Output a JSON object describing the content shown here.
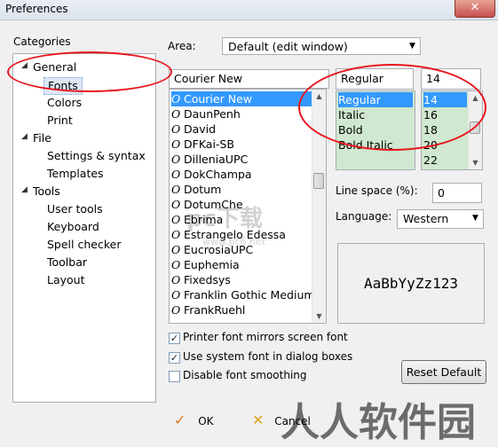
{
  "window": {
    "title": "Preferences",
    "close_glyph": "✕"
  },
  "categories": {
    "label": "Categories",
    "items": [
      {
        "label": "General",
        "level": 0,
        "expanded": true
      },
      {
        "label": "Fonts",
        "level": 1,
        "selected": true
      },
      {
        "label": "Colors",
        "level": 1
      },
      {
        "label": "Print",
        "level": 1
      },
      {
        "label": "File",
        "level": 0,
        "expanded": true
      },
      {
        "label": "Settings & syntax",
        "level": 1
      },
      {
        "label": "Templates",
        "level": 1
      },
      {
        "label": "Tools",
        "level": 0,
        "expanded": true
      },
      {
        "label": "User tools",
        "level": 1
      },
      {
        "label": "Keyboard",
        "level": 1
      },
      {
        "label": "Spell checker",
        "level": 1
      },
      {
        "label": "Toolbar",
        "level": 1
      },
      {
        "label": "Layout",
        "level": 1
      }
    ]
  },
  "area": {
    "label": "Area:",
    "value": "Default (edit window)"
  },
  "font": {
    "current": "Courier New",
    "list": [
      "Courier New",
      "DaunPenh",
      "David",
      "DFKai-SB",
      "DilleniaUPC",
      "DokChampa",
      "Dotum",
      "DotumChe",
      "Ebrima",
      "Estrangelo Edessa",
      "EucrosiaUPC",
      "Euphemia",
      "Fixedsys",
      "Franklin Gothic Medium",
      "FrankRuehl"
    ],
    "selected_index": 0,
    "type_glyph": "O"
  },
  "style": {
    "current": "Regular",
    "options": [
      "Regular",
      "Italic",
      "Bold",
      "Bold Italic"
    ],
    "selected_index": 0
  },
  "size": {
    "current": "14",
    "options": [
      "14",
      "16",
      "18",
      "20",
      "22"
    ],
    "selected_index": 0
  },
  "line_space": {
    "label": "Line space (%):",
    "value": "0"
  },
  "language": {
    "label": "Language:",
    "value": "Western"
  },
  "preview_text": "AaBbYyZz123",
  "checkboxes": [
    {
      "label": "Printer font mirrors screen font",
      "checked": true
    },
    {
      "label": "Use system font in dialog boxes",
      "checked": true
    },
    {
      "label": "Disable font smoothing",
      "checked": false
    }
  ],
  "reset_label": "Reset Default",
  "ok_label": "OK",
  "cancel_label": "Cancel",
  "watermark": {
    "main": "人人软件园",
    "site": "www.pc6.net",
    "brand": "pc下载"
  },
  "colors": {
    "selection": "#3399ff",
    "annotation": "#e8141c",
    "style_bg": "#cfe8cf",
    "ok_check": "#e0761c",
    "cancel_x": "#e0a020"
  }
}
